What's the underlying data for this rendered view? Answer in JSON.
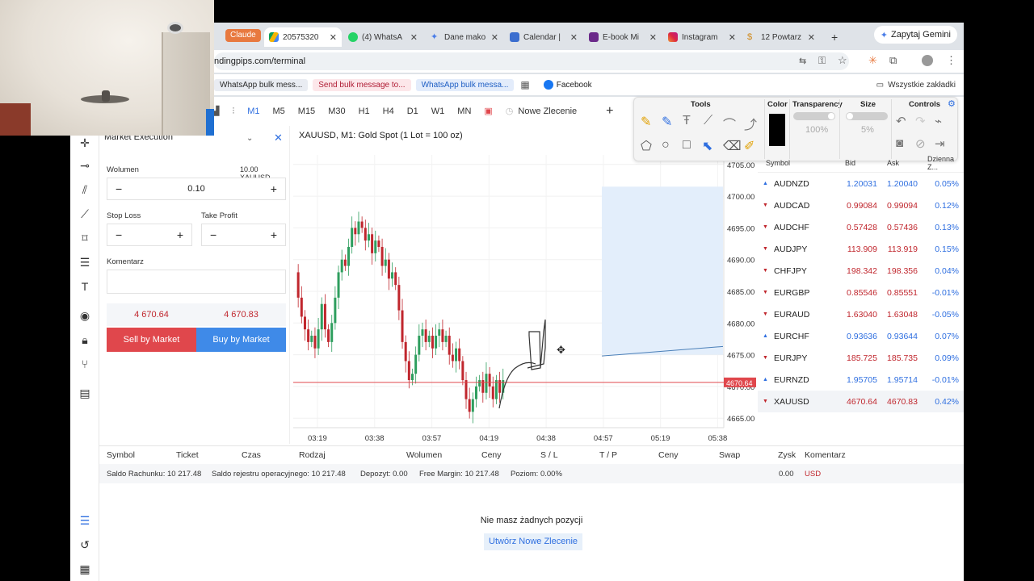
{
  "browser": {
    "claude_badge": "Claude",
    "tabs": [
      {
        "label": "20575320",
        "icon": "google-drive-icon",
        "active": true
      },
      {
        "label": "(4) WhatsA",
        "icon": "whatsapp-icon"
      },
      {
        "label": "Dane mako",
        "icon": "gemini-icon"
      },
      {
        "label": "Calendar |",
        "icon": "calendar-icon"
      },
      {
        "label": "E-book Mi",
        "icon": "ebook-icon"
      },
      {
        "label": "Instagram",
        "icon": "instagram-icon"
      },
      {
        "label": "12 Powtarz",
        "icon": "dollar-icon"
      }
    ],
    "gemini_button": "Zapytaj Gemini",
    "url": "ndingpips.com/terminal",
    "bookmarks": [
      "WhatsApp bulk mess...",
      "Send bulk message to...",
      "WhatsApp bulk messa..."
    ],
    "facebook": "Facebook",
    "all_bookmarks": "Wszystkie zakładki"
  },
  "toolbar": {
    "timeframes": [
      "M1",
      "M5",
      "M15",
      "M30",
      "H1",
      "H4",
      "D1",
      "W1",
      "MN"
    ],
    "selected": "M1",
    "new_order": "Nowe Zlecenie"
  },
  "order": {
    "mode": "Market Execution",
    "volume_label": "Wolumen",
    "volume_units": "10.00 XAUUSD",
    "volume_value": "0.10",
    "stop_loss": "Stop Loss",
    "take_profit": "Take Profit",
    "comment_label": "Komentarz",
    "sell_price": "4 670.64",
    "buy_price": "4 670.83",
    "sell_button": "Sell by Market",
    "buy_button": "Buy by Market"
  },
  "chart_data": {
    "type": "candlestick",
    "title": "XAUUSD, M1: Gold Spot (1 Lot = 100 oz)",
    "x_ticks": [
      "03:19",
      "03:38",
      "03:57",
      "04:19",
      "04:38",
      "04:57",
      "05:19",
      "05:38"
    ],
    "y_ticks": [
      4705.0,
      4700.0,
      4695.0,
      4690.0,
      4685.0,
      4680.0,
      4675.0,
      4670.0,
      4665.0
    ],
    "ylim": [
      4663.5,
      4706.5
    ],
    "current_price": 4670.64,
    "current_price_label": "4670.64",
    "close_path": [
      4688,
      4684,
      4681,
      4679,
      4677,
      4678,
      4676,
      4679,
      4683,
      4679,
      4677,
      4680,
      4684,
      4688,
      4690,
      4689,
      4692,
      4695,
      4694,
      4696,
      4695,
      4693,
      4694,
      4691,
      4693,
      4692,
      4689,
      4690,
      4687,
      4688,
      4686,
      4682,
      4677,
      4674,
      4671,
      4672,
      4675,
      4678,
      4679,
      4677,
      4678,
      4676,
      4678,
      4679,
      4677,
      4678,
      4675,
      4674,
      4676,
      4674,
      4671,
      4668,
      4666,
      4668,
      4670,
      4671,
      4669,
      4672,
      4670,
      4668,
      4671,
      4669,
      4671
    ],
    "projection_line": [
      4674.8,
      4676.3
    ]
  },
  "drawing": {
    "tools_title": "Tools",
    "color_title": "Color",
    "transparency_title": "Transparency",
    "transparency_value": "100%",
    "size_title": "Size",
    "size_value": "5%",
    "controls_title": "Controls"
  },
  "watchlist": {
    "headers": [
      "Symbol",
      "Bid",
      "Ask",
      "Dzienna Z..."
    ],
    "rows": [
      {
        "symbol": "AUDNZD",
        "bid": "1.20031",
        "ask": "1.20040",
        "change": "0.05%",
        "dir": "up"
      },
      {
        "symbol": "AUDCAD",
        "bid": "0.99084",
        "ask": "0.99094",
        "change": "0.12%",
        "dir": "dn"
      },
      {
        "symbol": "AUDCHF",
        "bid": "0.57428",
        "ask": "0.57436",
        "change": "0.13%",
        "dir": "dn"
      },
      {
        "symbol": "AUDJPY",
        "bid": "113.909",
        "ask": "113.919",
        "change": "0.15%",
        "dir": "dn"
      },
      {
        "symbol": "CHFJPY",
        "bid": "198.342",
        "ask": "198.356",
        "change": "0.04%",
        "dir": "dn"
      },
      {
        "symbol": "EURGBP",
        "bid": "0.85546",
        "ask": "0.85551",
        "change": "-0.01%",
        "dir": "dn"
      },
      {
        "symbol": "EURAUD",
        "bid": "1.63040",
        "ask": "1.63048",
        "change": "-0.05%",
        "dir": "dn"
      },
      {
        "symbol": "EURCHF",
        "bid": "0.93636",
        "ask": "0.93644",
        "change": "0.07%",
        "dir": "up"
      },
      {
        "symbol": "EURJPY",
        "bid": "185.725",
        "ask": "185.735",
        "change": "0.09%",
        "dir": "dn"
      },
      {
        "symbol": "EURNZD",
        "bid": "1.95705",
        "ask": "1.95714",
        "change": "-0.01%",
        "dir": "up"
      },
      {
        "symbol": "XAUUSD",
        "bid": "4670.64",
        "ask": "4670.83",
        "change": "0.42%",
        "dir": "dn"
      }
    ]
  },
  "positions": {
    "headers": [
      "Symbol",
      "Ticket",
      "Czas",
      "Rodzaj",
      "Wolumen",
      "Ceny",
      "S / L",
      "T / P",
      "Ceny",
      "Swap",
      "Zysk",
      "Komentarz"
    ],
    "saldo": "Saldo Rachunku: 10 217.48",
    "saldo_rej": "Saldo rejestru operacyjnego: 10 217.48",
    "depozyt": "Depozyt: 0.00",
    "free_margin": "Free Margin: 10 217.48",
    "poziom": "Poziom: 0.00%",
    "zysk": "0.00",
    "currency": "USD",
    "empty": "Nie masz żadnych pozycji",
    "create": "Utwórz Nowe Zlecenie"
  },
  "colors": {
    "up": "#2f6fe0",
    "down": "#c0262d",
    "sell": "#e0474c",
    "buy": "#3f8ae8",
    "shade": "#e3eefb"
  }
}
